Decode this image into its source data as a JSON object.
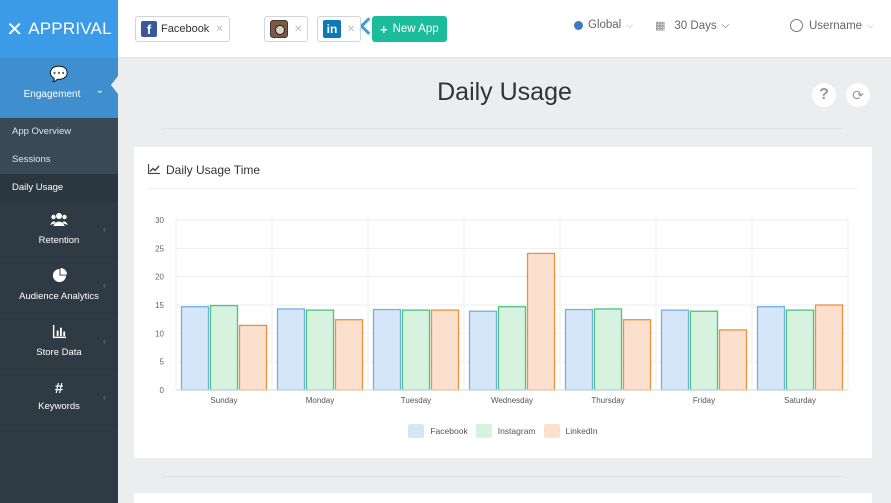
{
  "app": {
    "logo_text": "APPRIVAL",
    "logo_mark": "✕"
  },
  "sidebar": {
    "active": {
      "label": "Engagement",
      "icon": "chat-icon"
    },
    "subitems": [
      {
        "label": "App Overview"
      },
      {
        "label": "Sessions"
      },
      {
        "label": "Daily Usage",
        "active": true
      }
    ],
    "items": [
      {
        "label": "Retention",
        "icon": "users-icon",
        "glyph": "👥"
      },
      {
        "label": "Audience Analytics",
        "icon": "pie-chart-icon",
        "glyph": "◔"
      },
      {
        "label": "Store Data",
        "icon": "bar-chart-icon",
        "glyph": "▥"
      },
      {
        "label": "Keywords",
        "icon": "hashtag-icon",
        "glyph": "#"
      }
    ]
  },
  "topbar": {
    "facebook_label": "Facebook",
    "new_app_label": "New App",
    "region": "Global",
    "range": "30 Days",
    "username": "Username"
  },
  "page": {
    "title": "Daily Usage"
  },
  "card": {
    "title": "Daily Usage Time"
  },
  "colors": {
    "facebook_fill": "#d4e6f7",
    "facebook_stroke": "#73aee6",
    "instagram_fill": "#d7f3df",
    "instagram_stroke": "#4bc47a",
    "linkedin_fill": "#fbe0cd",
    "linkedin_stroke": "#ec8f3f"
  },
  "chart_data": {
    "type": "bar",
    "categories": [
      "Sunday",
      "Monday",
      "Tuesday",
      "Wednesday",
      "Thursday",
      "Friday",
      "Saturday"
    ],
    "series": [
      {
        "name": "Facebook",
        "values": [
          14.7,
          14.3,
          14.2,
          13.9,
          14.2,
          14.1,
          14.7
        ]
      },
      {
        "name": "Instagram",
        "values": [
          14.9,
          14.1,
          14.1,
          14.7,
          14.3,
          13.9,
          14.1
        ]
      },
      {
        "name": "LinkedIn",
        "values": [
          11.4,
          12.4,
          14.1,
          24.1,
          12.4,
          10.6,
          15.0
        ]
      }
    ],
    "yticks": [
      0,
      5,
      10,
      15,
      20,
      25,
      30
    ],
    "ylim": [
      0,
      30
    ],
    "grid": true,
    "legend": "bottom-center"
  }
}
